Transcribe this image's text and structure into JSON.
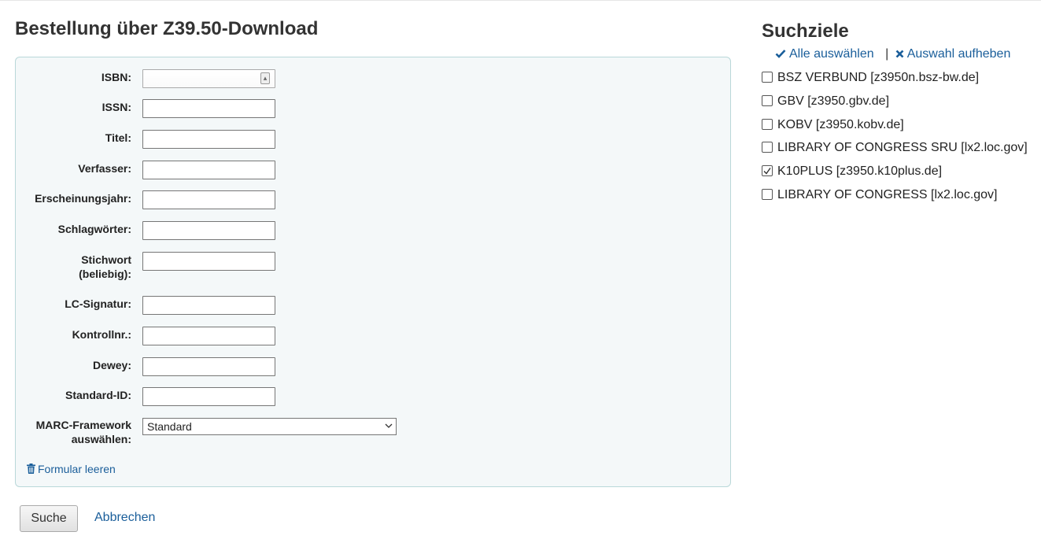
{
  "page": {
    "title": "Bestellung über Z39.50-Download"
  },
  "form": {
    "fields": [
      {
        "label": "ISBN:",
        "value": ""
      },
      {
        "label": "ISSN:",
        "value": ""
      },
      {
        "label": "Titel:",
        "value": ""
      },
      {
        "label": "Verfasser:",
        "value": ""
      },
      {
        "label": "Erscheinungsjahr:",
        "value": ""
      },
      {
        "label": "Schlagwörter:",
        "value": ""
      },
      {
        "label_line1": "Stichwort",
        "label_line2": "(beliebig):",
        "value": ""
      },
      {
        "label": "LC-Signatur:",
        "value": ""
      },
      {
        "label": "Kontrollnr.:",
        "value": ""
      },
      {
        "label": "Dewey:",
        "value": ""
      },
      {
        "label": "Standard-ID:",
        "value": ""
      }
    ],
    "framework": {
      "label_line1": "MARC-Framework",
      "label_line2": "auswählen:",
      "selected": "Standard"
    },
    "clear_label": "Formular leeren"
  },
  "actions": {
    "search_label": "Suche",
    "cancel_label": "Abbrechen"
  },
  "targets": {
    "title": "Suchziele",
    "select_all_label": "Alle auswählen",
    "separator": "|",
    "clear_selection_label": "Auswahl aufheben",
    "items": [
      {
        "label": "BSZ VERBUND [z3950n.bsz-bw.de]",
        "checked": false
      },
      {
        "label": "GBV [z3950.gbv.de]",
        "checked": false
      },
      {
        "label": "KOBV [z3950.kobv.de]",
        "checked": false
      },
      {
        "label": "LIBRARY OF CONGRESS SRU [lx2.loc.gov]",
        "checked": false
      },
      {
        "label": "K10PLUS [z3950.k10plus.de]",
        "checked": true
      },
      {
        "label": "LIBRARY OF CONGRESS [lx2.loc.gov]",
        "checked": false
      }
    ]
  },
  "colors": {
    "link": "#1a5e9a",
    "panel_bg": "#f4f8f9",
    "panel_border": "#b9d8d9"
  }
}
